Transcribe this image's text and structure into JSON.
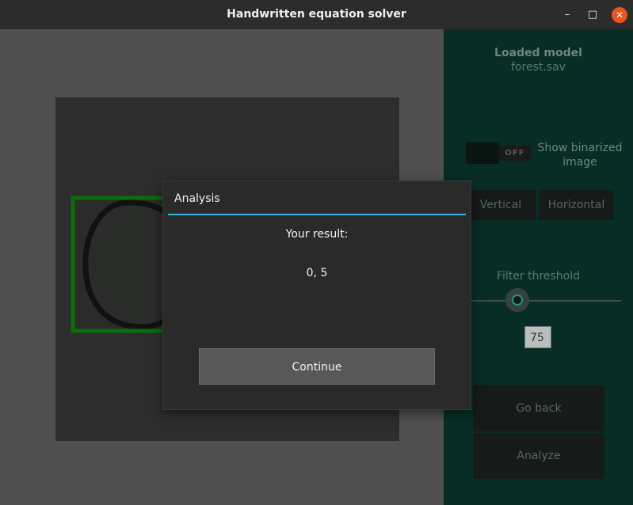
{
  "window": {
    "title": "Handwritten equation solver",
    "controls": {
      "minimize": "–",
      "maximize": "□",
      "close": "✕"
    }
  },
  "sidebar": {
    "model_title": "Loaded model",
    "model_name": "forest.sav",
    "toggle": {
      "state_text": "OFF",
      "label": "Show binarized image"
    },
    "split_buttons": {
      "vertical": "Vertical",
      "horizontal": "Horizontal"
    },
    "filter": {
      "label": "Filter threshold",
      "value": "75"
    },
    "go_back": "Go back",
    "analyze": "Analyze"
  },
  "dialog": {
    "title": "Analysis",
    "label": "Your result:",
    "result": "0, 5",
    "button": "Continue"
  },
  "colors": {
    "sidebar_bg": "#082d27",
    "accent_line": "#33b5e5",
    "bounding_box": "#0a6e0a",
    "close_button": "#e95420"
  },
  "icons": {
    "close": "close-icon",
    "minimize": "minimize-icon",
    "maximize": "maximize-icon"
  }
}
